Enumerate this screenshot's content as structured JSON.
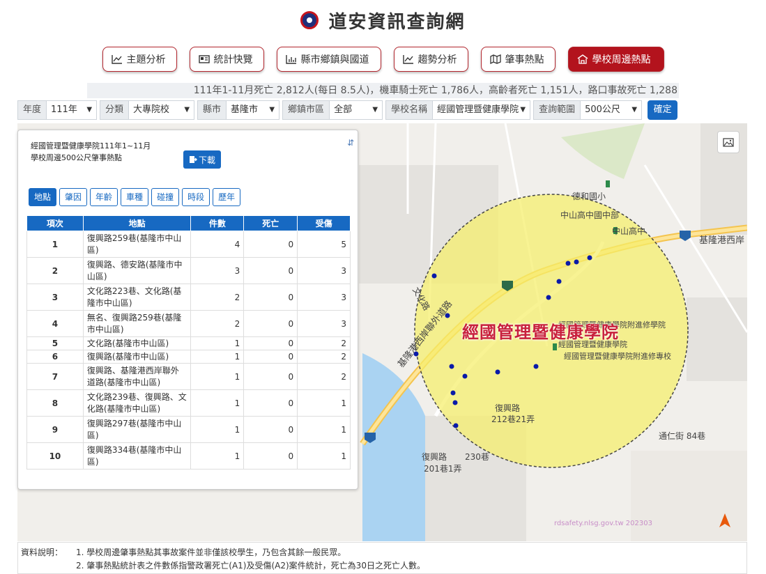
{
  "header": {
    "title": "道安資訊查詢網"
  },
  "nav": [
    {
      "label": "主題分析",
      "icon": "chart-line-icon",
      "active": false
    },
    {
      "label": "統計快覽",
      "icon": "newspaper-icon",
      "active": false
    },
    {
      "label": "縣市鄉鎮與國道",
      "icon": "bar-chart-icon",
      "active": false
    },
    {
      "label": "趨勢分析",
      "icon": "chart-area-icon",
      "active": false
    },
    {
      "label": "肇事熱點",
      "icon": "map-icon",
      "active": false
    },
    {
      "label": "學校周邊熱點",
      "icon": "school-icon",
      "active": true
    }
  ],
  "stat_bar": "111年1-11月死亡 2,812人(每日 8.5人)，機車騎士死亡 1,786人，高齡者死亡 1,151人，路口事故死亡 1,288",
  "filters": {
    "year_label": "年度",
    "year_value": "111年",
    "category_label": "分類",
    "category_value": "大專院校",
    "county_label": "縣市",
    "county_value": "基隆市",
    "town_label": "鄉鎮市區",
    "town_value": "全部",
    "school_label": "學校名稱",
    "school_value": "經國管理暨健康學院",
    "range_label": "查詢範圍",
    "range_value": "500公尺",
    "confirm": "確定"
  },
  "panel": {
    "title_line1": "經國管理暨健康學院111年1~11月",
    "title_line2": "學校周邊500公尺肇事熱點",
    "download": "下載",
    "tabs": [
      "地點",
      "肇因",
      "年齡",
      "車種",
      "碰撞",
      "時段",
      "歷年"
    ],
    "active_tab": "地點",
    "columns": [
      "項次",
      "地點",
      "件數",
      "死亡",
      "受傷"
    ],
    "rows": [
      {
        "no": "1",
        "loc": "復興路259巷(基隆市中山區)",
        "count": "4",
        "death": "0",
        "injury": "5"
      },
      {
        "no": "2",
        "loc": "復興路、德安路(基隆市中山區)",
        "count": "3",
        "death": "0",
        "injury": "3"
      },
      {
        "no": "3",
        "loc": "文化路223巷、文化路(基隆市中山區)",
        "count": "2",
        "death": "0",
        "injury": "3"
      },
      {
        "no": "4",
        "loc": "無名、復興路259巷(基隆市中山區)",
        "count": "2",
        "death": "0",
        "injury": "3"
      },
      {
        "no": "5",
        "loc": "文化路(基隆市中山區)",
        "count": "1",
        "death": "0",
        "injury": "2"
      },
      {
        "no": "6",
        "loc": "復興路(基隆市中山區)",
        "count": "1",
        "death": "0",
        "injury": "2"
      },
      {
        "no": "7",
        "loc": "復興路、基隆港西岸聯外道路(基隆市中山區)",
        "count": "1",
        "death": "0",
        "injury": "2"
      },
      {
        "no": "8",
        "loc": "文化路239巷、復興路、文化路(基隆市中山區)",
        "count": "1",
        "death": "0",
        "injury": "1"
      },
      {
        "no": "9",
        "loc": "復興路297巷(基隆市中山區)",
        "count": "1",
        "death": "0",
        "injury": "1"
      },
      {
        "no": "10",
        "loc": "復興路334巷(基隆市中山區)",
        "count": "1",
        "death": "0",
        "injury": "1"
      }
    ]
  },
  "map": {
    "school_label": "經國管理暨健康學院",
    "labels": {
      "dehe": "德和國小",
      "zhongshan_mid": "中山高中國中部",
      "zhongshan_high": "中山高中",
      "coast_road": "基隆港西岸",
      "school_small1": "經國管理暨健康學院",
      "school_small2": "經國管理暨健康學院附進修專校",
      "school_small3": "經國管理暨健康學院附進修學院",
      "fuxing1": "復興路",
      "fuxing2": "復興路",
      "fuxing_lane": "212巷21弄",
      "tongren": "通仁街 84巷",
      "lane201": "201巷1弄",
      "lane230": "230巷",
      "outer_road": "基隆港西岸聯外道路",
      "wenhua": "文化路",
      "route2a": "2",
      "route2b": "2"
    },
    "watermark": "rdsafety.nlsg.gov.tw 202303",
    "icon_names": [
      "image-export-icon",
      "north-arrow-icon"
    ]
  },
  "notes": {
    "label": "資料說明：",
    "line1": "1. 學校周邊肇事熱點其事故案件並非僅該校學生，乃包含其餘一般民眾。",
    "line2": "2. 肇事熱點統計表之件數係指警政署死亡(A1)及受傷(A2)案件統計，死亡為30日之死亡人數。"
  },
  "colors": {
    "brand_red": "#b3131d",
    "primary_blue": "#1769c2",
    "circle_fill": "#f5ee6a",
    "point": "#0a1aa8"
  }
}
